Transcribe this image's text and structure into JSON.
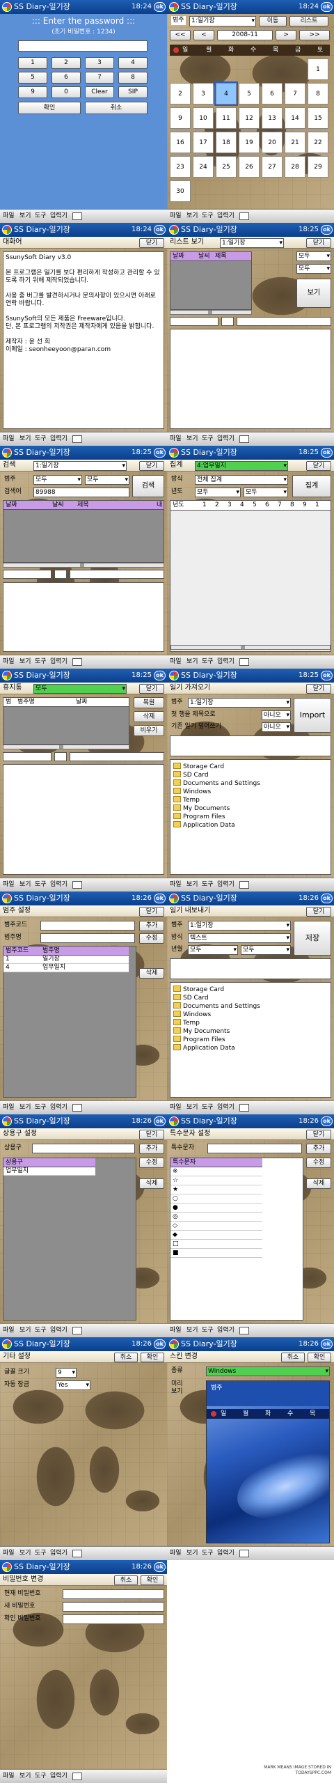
{
  "app_title": "SS Diary-일기장",
  "times": [
    "18:24",
    "18:24",
    "18:24",
    "18:25",
    "18:25",
    "18:25",
    "18:25",
    "18:25",
    "18:26",
    "18:26",
    "18:26",
    "18:26",
    "18:26",
    "18:26",
    "18:26"
  ],
  "ok_label": "ok",
  "menu": {
    "file": "파일",
    "view": "보기",
    "tools": "도구",
    "input": "입력기"
  },
  "password": {
    "title": "::: Enter the password :::",
    "hint": "(초기 비밀번호 : 1234)",
    "keys": [
      "1",
      "2",
      "3",
      "4",
      "5",
      "6",
      "7",
      "8",
      "9",
      "0",
      "Clear",
      "SIP"
    ],
    "confirm": "확인",
    "cancel": "취소"
  },
  "calendar": {
    "cat_label": "범주",
    "cat_value": "1:일기장",
    "move": "이동",
    "list": "리스트",
    "prev2": "<<",
    "prev": "<",
    "month": "2008-11",
    "next": ">",
    "next2": ">>",
    "weekdays": [
      "일",
      "월",
      "화",
      "수",
      "목",
      "금",
      "토"
    ],
    "days": [
      "",
      "",
      "",
      "",
      "",
      "",
      "1",
      "2",
      "3",
      "4",
      "5",
      "6",
      "7",
      "8",
      "9",
      "10",
      "11",
      "12",
      "13",
      "14",
      "15",
      "16",
      "17",
      "18",
      "19",
      "20",
      "21",
      "22",
      "23",
      "24",
      "25",
      "26",
      "27",
      "28",
      "29",
      "30"
    ],
    "today": "4"
  },
  "about": {
    "title": "대화어",
    "close": "닫기",
    "text": [
      "SsunySoft Diary v3.0",
      "",
      "본 프로그램은 일기를 보다 편리하게 작성하고 관리할 수 있도록 하기 위해 제작되었습니다.",
      "",
      "사용 중 버그를 발견하시거나 문의사항이 있으시면 아래로 연락 바랍니다.",
      "",
      "SsunySoft의 모든 제품은 Freeware입니다.",
      "단, 본 프로그램의 저작권은 제작자에게 있음을 밝힙니다.",
      "",
      "제작자 : 윤 선 희",
      "이메일 : seonheeyoon@paran.com"
    ]
  },
  "listview": {
    "title": "리스트 보기",
    "cat_value": "1:일기장",
    "close": "닫기",
    "cols": [
      "날짜",
      "날씨",
      "제목"
    ],
    "all1": "모두",
    "all2": "모두",
    "view": "보기"
  },
  "search": {
    "title": "검색",
    "cat_value": "1:일기장",
    "close": "닫기",
    "cat_label": "범주",
    "all1": "모두",
    "all2": "모두",
    "keyword_label": "검색어",
    "keyword": "89988",
    "go": "검색",
    "cols": [
      "날짜",
      "날씨",
      "제목",
      "내"
    ]
  },
  "stats": {
    "title": "집계",
    "cat_value": "4:업무일지",
    "close": "닫기",
    "method_label": "방식",
    "method": "전체 집계",
    "year_label": "년도",
    "all1": "모두",
    "all2": "모두",
    "go": "집계",
    "cols": [
      "년도",
      "1",
      "2",
      "3",
      "4",
      "5",
      "6",
      "7",
      "8",
      "9",
      "1"
    ]
  },
  "trash": {
    "title": "휴지통",
    "cat_value": "모두",
    "close": "닫기",
    "cols": [
      "범",
      "범주명",
      "날짜"
    ],
    "restore": "복원",
    "delete": "삭제",
    "empty": "비우기"
  },
  "import": {
    "title": "일기 가져오기",
    "close": "닫기",
    "cat_label": "범주",
    "cat_value": "1:일기장",
    "first_row_label": "첫 행을 제목으로",
    "first_row_value": "아니오",
    "date_label": "기존 일기 덮어쓰기",
    "date_value": "아니오",
    "go": "Import",
    "folders": [
      "Storage Card",
      "SD Card",
      "Documents and Settings",
      "Windows",
      "Temp",
      "My Documents",
      "Program Files",
      "Application Data"
    ]
  },
  "category": {
    "title": "범주 설정",
    "close": "닫기",
    "code_label": "범주코드",
    "name_label": "범주명",
    "add": "추가",
    "edit": "수정",
    "delete": "삭제",
    "cols": [
      "범주코드",
      "범주명"
    ],
    "rows": [
      [
        "1",
        "일기장"
      ],
      [
        "4",
        "업무일지"
      ]
    ]
  },
  "export": {
    "title": "일기 내보내기",
    "close": "닫기",
    "cat_label": "범주",
    "cat_value": "1:일기장",
    "format_label": "방식",
    "format_value": "텍스트",
    "month_label": "년월",
    "all1": "모두",
    "all2": "모두",
    "save": "저장",
    "folders": [
      "Storage Card",
      "SD Card",
      "Documents and Settings",
      "Windows",
      "Temp",
      "My Documents",
      "Program Files",
      "Application Data"
    ]
  },
  "phrases": {
    "title": "상용구 설정",
    "close": "닫기",
    "label": "상용구",
    "add": "추가",
    "edit": "수정",
    "delete": "삭제",
    "col": "상용구",
    "rows": [
      "업무일지"
    ]
  },
  "symbols": {
    "title": "특수문자 설정",
    "close": "닫기",
    "label": "특수문자",
    "add": "추가",
    "edit": "수정",
    "delete": "삭제",
    "col": "특수문자",
    "rows": [
      "※",
      "☆",
      "★",
      "○",
      "●",
      "◎",
      "◇",
      "◆",
      "□",
      "■"
    ]
  },
  "misc": {
    "title": "기타 설정",
    "cancel": "취소",
    "ok": "확인",
    "font_label": "글꼴 크기",
    "font_value": "9",
    "autolock_label": "자동 잠금",
    "autolock_value": "Yes"
  },
  "skin": {
    "title": "스킨 변경",
    "cancel": "취소",
    "ok": "확인",
    "kind_label": "종류",
    "kind_value": "Windows",
    "preview_label": "미리보기",
    "preview_cat": "범주",
    "preview_days": [
      "일",
      "월",
      "화",
      "수",
      "목"
    ]
  },
  "pwchange": {
    "title": "비밀번호 변경",
    "cancel": "취소",
    "ok": "확인",
    "current": "현재 비밀번호",
    "new": "새 비밀번호",
    "confirm": "확인 비밀번호"
  },
  "footer": {
    "line1": "MARK MEANS IMAGE STORED IN",
    "line2": "TODAYSPPC.COM"
  },
  "colors": {
    "titlebar": "#0a3f8c",
    "header": "#c79be6",
    "green": "#4fd14f",
    "highlight": "#2a5cc0",
    "password_bg": "#5b8fd6"
  }
}
